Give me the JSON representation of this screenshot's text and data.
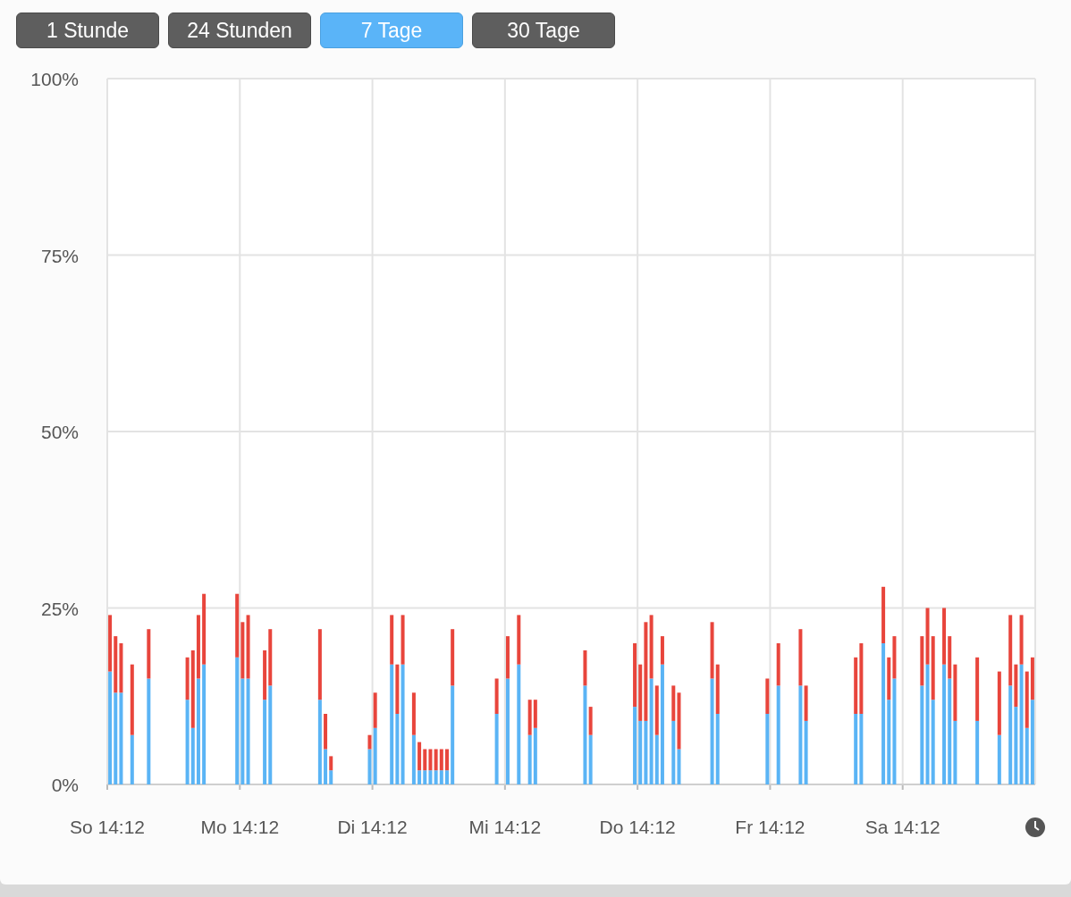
{
  "range_buttons": [
    {
      "label": "1 Stunde",
      "selected": false
    },
    {
      "label": "24 Stunden",
      "selected": false
    },
    {
      "label": "7 Tage",
      "selected": true
    },
    {
      "label": "30 Tage",
      "selected": false
    }
  ],
  "chart_data": {
    "type": "bar",
    "stacked": true,
    "grid": true,
    "ylim": [
      0,
      100
    ],
    "categories": [
      "So 14:12",
      null,
      null,
      null,
      null,
      null,
      null,
      null,
      null,
      null,
      null,
      null,
      null,
      null,
      null,
      null,
      null,
      null,
      null,
      null,
      null,
      null,
      null,
      null,
      "Mo 14:12",
      null,
      null,
      null,
      null,
      null,
      null,
      null,
      null,
      null,
      null,
      null,
      null,
      null,
      null,
      null,
      null,
      null,
      null,
      null,
      null,
      null,
      null,
      null,
      "Di 14:12",
      null,
      null,
      null,
      null,
      null,
      null,
      null,
      null,
      null,
      null,
      null,
      null,
      null,
      null,
      null,
      null,
      null,
      null,
      null,
      null,
      null,
      null,
      null,
      "Mi 14:12",
      null,
      null,
      null,
      null,
      null,
      null,
      null,
      null,
      null,
      null,
      null,
      null,
      null,
      null,
      null,
      null,
      null,
      null,
      null,
      null,
      null,
      null,
      null,
      "Do 14:12",
      null,
      null,
      null,
      null,
      null,
      null,
      null,
      null,
      null,
      null,
      null,
      null,
      null,
      null,
      null,
      null,
      null,
      null,
      null,
      null,
      null,
      null,
      null,
      "Fr 14:12",
      null,
      null,
      null,
      null,
      null,
      null,
      null,
      null,
      null,
      null,
      null,
      null,
      null,
      null,
      null,
      null,
      null,
      null,
      null,
      null,
      null,
      null,
      null,
      "Sa 14:12",
      null,
      null,
      null,
      null,
      null,
      null,
      null,
      null,
      null,
      null,
      null,
      null,
      null,
      null,
      null,
      null,
      null,
      null,
      null,
      null,
      null,
      null,
      null
    ],
    "series": [
      {
        "color": "#5ab4f5",
        "values": [
          16,
          13,
          13,
          0,
          7,
          0,
          0,
          15,
          0,
          0,
          0,
          0,
          0,
          0,
          12,
          8,
          15,
          17,
          0,
          0,
          0,
          0,
          0,
          18,
          15,
          15,
          0,
          0,
          12,
          14,
          0,
          0,
          0,
          0,
          0,
          0,
          0,
          0,
          12,
          5,
          2,
          0,
          0,
          0,
          0,
          0,
          0,
          5,
          8,
          0,
          0,
          17,
          10,
          17,
          0,
          7,
          2,
          2,
          2,
          2,
          2,
          2,
          14,
          0,
          0,
          0,
          0,
          0,
          0,
          0,
          10,
          0,
          15,
          0,
          17,
          0,
          7,
          8,
          0,
          0,
          0,
          0,
          0,
          0,
          0,
          0,
          14,
          7,
          0,
          0,
          0,
          0,
          0,
          0,
          0,
          11,
          9,
          9,
          15,
          7,
          17,
          0,
          9,
          5,
          0,
          0,
          0,
          0,
          0,
          15,
          10,
          0,
          0,
          0,
          0,
          0,
          0,
          0,
          0,
          10,
          0,
          14,
          0,
          0,
          0,
          14,
          9,
          0,
          0,
          0,
          0,
          0,
          0,
          0,
          0,
          10,
          10,
          0,
          0,
          0,
          20,
          12,
          15,
          0,
          0,
          0,
          0,
          14,
          17,
          12,
          0,
          17,
          15,
          9,
          0,
          0,
          0,
          9,
          0,
          0,
          0,
          7,
          0,
          14,
          11,
          17,
          8,
          12
        ]
      },
      {
        "color": "#e8453c",
        "values": [
          8,
          8,
          7,
          0,
          10,
          0,
          0,
          7,
          0,
          0,
          0,
          0,
          0,
          0,
          6,
          11,
          9,
          10,
          0,
          0,
          0,
          0,
          0,
          9,
          8,
          9,
          0,
          0,
          7,
          8,
          0,
          0,
          0,
          0,
          0,
          0,
          0,
          0,
          10,
          5,
          2,
          0,
          0,
          0,
          0,
          0,
          0,
          2,
          5,
          0,
          0,
          7,
          7,
          7,
          0,
          6,
          4,
          3,
          3,
          3,
          3,
          3,
          8,
          0,
          0,
          0,
          0,
          0,
          0,
          0,
          5,
          0,
          6,
          0,
          7,
          0,
          5,
          4,
          0,
          0,
          0,
          0,
          0,
          0,
          0,
          0,
          5,
          4,
          0,
          0,
          0,
          0,
          0,
          0,
          0,
          9,
          8,
          14,
          9,
          7,
          4,
          0,
          5,
          8,
          0,
          0,
          0,
          0,
          0,
          8,
          7,
          0,
          0,
          0,
          0,
          0,
          0,
          0,
          0,
          5,
          0,
          6,
          0,
          0,
          0,
          8,
          5,
          0,
          0,
          0,
          0,
          0,
          0,
          0,
          0,
          8,
          10,
          0,
          0,
          0,
          8,
          6,
          6,
          0,
          0,
          0,
          0,
          7,
          8,
          9,
          0,
          8,
          6,
          8,
          0,
          0,
          0,
          9,
          0,
          0,
          0,
          9,
          0,
          10,
          6,
          7,
          8,
          6
        ]
      }
    ],
    "yticks": [
      {
        "value": 0,
        "label": "0%"
      },
      {
        "value": 25,
        "label": "25%"
      },
      {
        "value": 50,
        "label": "50%"
      },
      {
        "value": 75,
        "label": "75%"
      },
      {
        "value": 100,
        "label": "100%"
      }
    ]
  }
}
